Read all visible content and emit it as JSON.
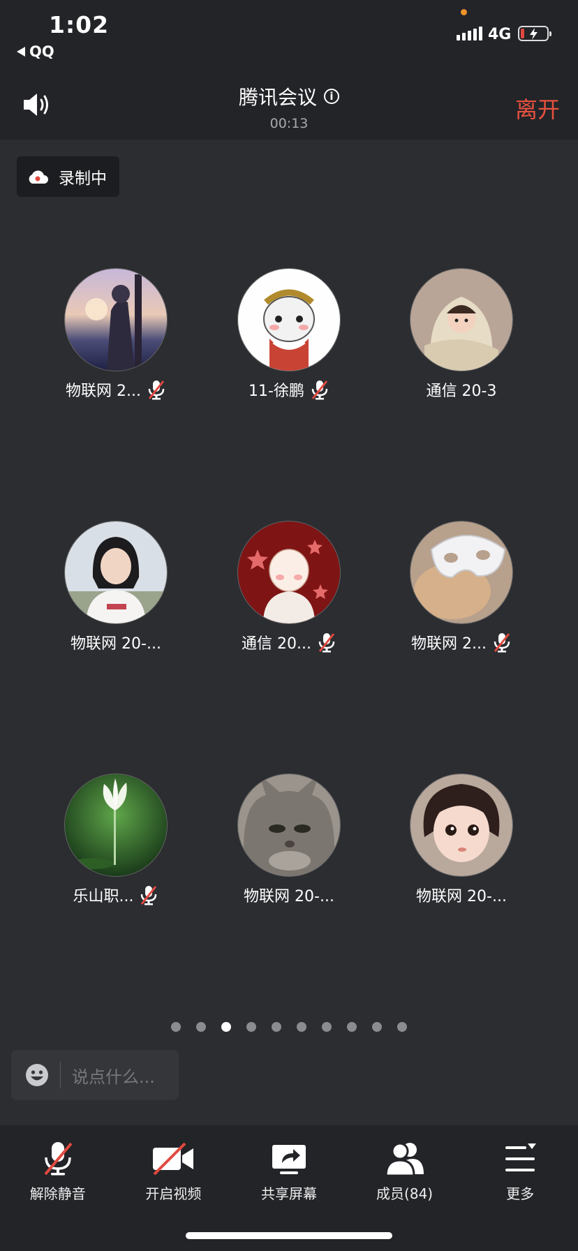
{
  "status_bar": {
    "time": "1:02",
    "back_app": "QQ",
    "network": "4G"
  },
  "header": {
    "title": "腾讯会议",
    "timer": "00:13",
    "leave_label": "离开"
  },
  "recording_badge": {
    "label": "录制中"
  },
  "participants": [
    {
      "name": "物联网 2...",
      "muted": true
    },
    {
      "name": "11-徐鹏",
      "muted": true
    },
    {
      "name": "通信 20-3",
      "muted": false
    },
    {
      "name": "物联网 20-...",
      "muted": false
    },
    {
      "name": "通信 20...",
      "muted": true
    },
    {
      "name": "物联网 2...",
      "muted": true
    },
    {
      "name": "乐山职...",
      "muted": true
    },
    {
      "name": "物联网 20-...",
      "muted": false
    },
    {
      "name": "物联网 20-...",
      "muted": false
    }
  ],
  "pagination": {
    "total": 10,
    "current_index": 2
  },
  "chat": {
    "placeholder": "说点什么..."
  },
  "toolbar": [
    {
      "label": "解除静音",
      "icon": "mic-muted-icon"
    },
    {
      "label": "开启视频",
      "icon": "video-off-icon"
    },
    {
      "label": "共享屏幕",
      "icon": "share-screen-icon"
    },
    {
      "label": "成员(84)",
      "icon": "members-icon"
    },
    {
      "label": "更多",
      "icon": "more-menu-icon"
    }
  ],
  "colors": {
    "background": "#2b2d31",
    "bar": "#232428",
    "leave": "#e8523f",
    "mute_slash": "#e1493f"
  }
}
